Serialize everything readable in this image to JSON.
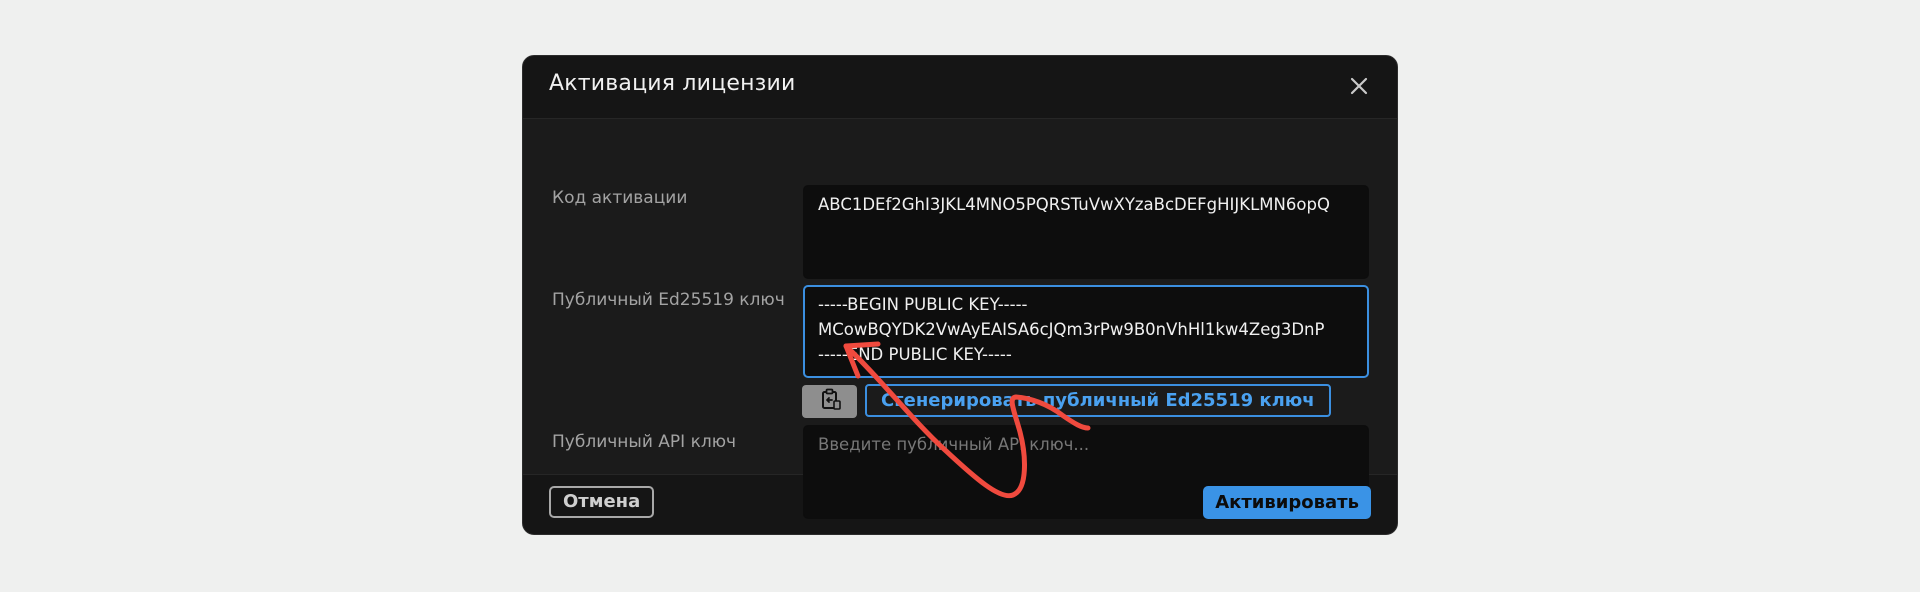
{
  "dialog": {
    "title": "Активация лицензии",
    "close_icon": "close-icon"
  },
  "fields": {
    "activation_code": {
      "label": "Код активации",
      "value": "ABC1DEf2GhI3JKL4MNO5PQRSTuVwXYzaBcDEFgHIJKLMN6opQ"
    },
    "public_key": {
      "label": "Публичный Ed25519 ключ",
      "lines": [
        "-----BEGIN PUBLIC KEY-----",
        "MCowBQYDK2VwAyEAISA6cJQm3rPw9B0nVhHl1kw4Zeg3DnP",
        "-----END PUBLIC KEY-----"
      ]
    },
    "api_key": {
      "label": "Публичный API ключ",
      "placeholder": "Введите публичный API ключ..."
    }
  },
  "actions": {
    "copy_icon": "clipboard-copy-icon",
    "generate_label": "Сгенерировать публичный Ed25519 ключ",
    "cancel_label": "Отмена",
    "activate_label": "Активировать"
  },
  "colors": {
    "accent": "#3a93e6",
    "annotation_arrow": "#f04a3e"
  }
}
